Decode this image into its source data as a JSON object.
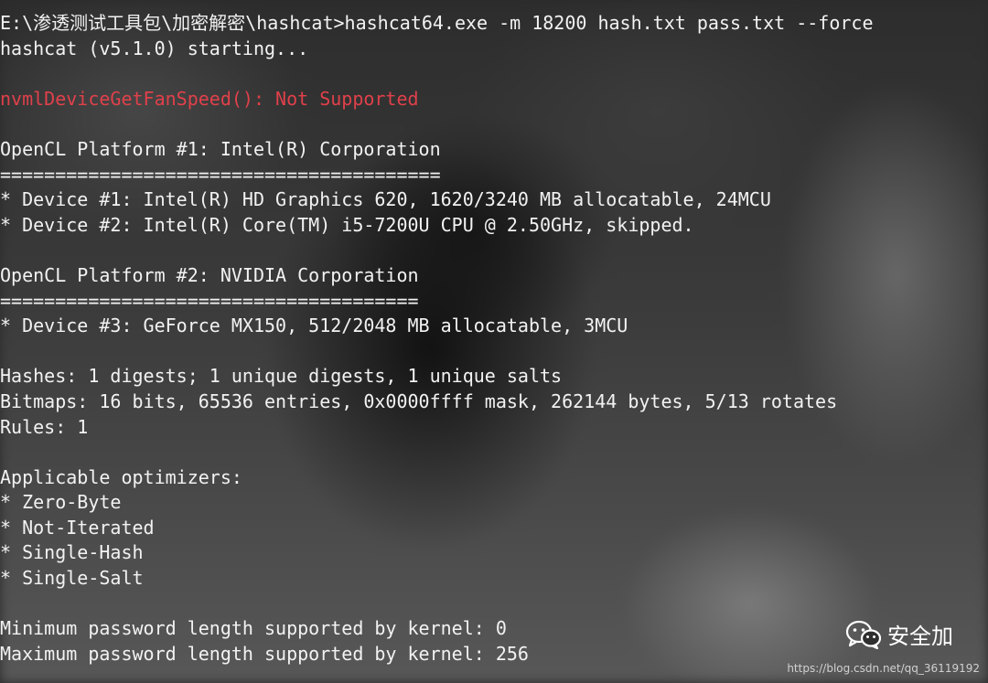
{
  "terminal": {
    "lines": [
      {
        "text": "E:\\渗透测试工具包\\加密解密\\hashcat>hashcat64.exe -m 18200 hash.txt pass.txt --force",
        "kind": "normal"
      },
      {
        "text": "hashcat (v5.1.0) starting...",
        "kind": "normal"
      },
      {
        "text": "",
        "kind": "normal"
      },
      {
        "text": "nvmlDeviceGetFanSpeed(): Not Supported",
        "kind": "error"
      },
      {
        "text": "",
        "kind": "normal"
      },
      {
        "text": "OpenCL Platform #1: Intel(R) Corporation",
        "kind": "normal"
      },
      {
        "text": "========================================",
        "kind": "normal"
      },
      {
        "text": "* Device #1: Intel(R) HD Graphics 620, 1620/3240 MB allocatable, 24MCU",
        "kind": "normal"
      },
      {
        "text": "* Device #2: Intel(R) Core(TM) i5-7200U CPU @ 2.50GHz, skipped.",
        "kind": "normal"
      },
      {
        "text": "",
        "kind": "normal"
      },
      {
        "text": "OpenCL Platform #2: NVIDIA Corporation",
        "kind": "normal"
      },
      {
        "text": "======================================",
        "kind": "normal"
      },
      {
        "text": "* Device #3: GeForce MX150, 512/2048 MB allocatable, 3MCU",
        "kind": "normal"
      },
      {
        "text": "",
        "kind": "normal"
      },
      {
        "text": "Hashes: 1 digests; 1 unique digests, 1 unique salts",
        "kind": "normal"
      },
      {
        "text": "Bitmaps: 16 bits, 65536 entries, 0x0000ffff mask, 262144 bytes, 5/13 rotates",
        "kind": "normal"
      },
      {
        "text": "Rules: 1",
        "kind": "normal"
      },
      {
        "text": "",
        "kind": "normal"
      },
      {
        "text": "Applicable optimizers:",
        "kind": "normal"
      },
      {
        "text": "* Zero-Byte",
        "kind": "normal"
      },
      {
        "text": "* Not-Iterated",
        "kind": "normal"
      },
      {
        "text": "* Single-Hash",
        "kind": "normal"
      },
      {
        "text": "* Single-Salt",
        "kind": "normal"
      },
      {
        "text": "",
        "kind": "normal"
      },
      {
        "text": "Minimum password length supported by kernel: 0",
        "kind": "normal"
      },
      {
        "text": "Maximum password length supported by kernel: 256",
        "kind": "normal"
      }
    ],
    "colors": {
      "text": "#f2f2f2",
      "error": "#e0404a"
    }
  },
  "watermark": {
    "icon": "wechat-icon",
    "label": "安全加",
    "url": "https://blog.csdn.net/qq_36119192"
  }
}
